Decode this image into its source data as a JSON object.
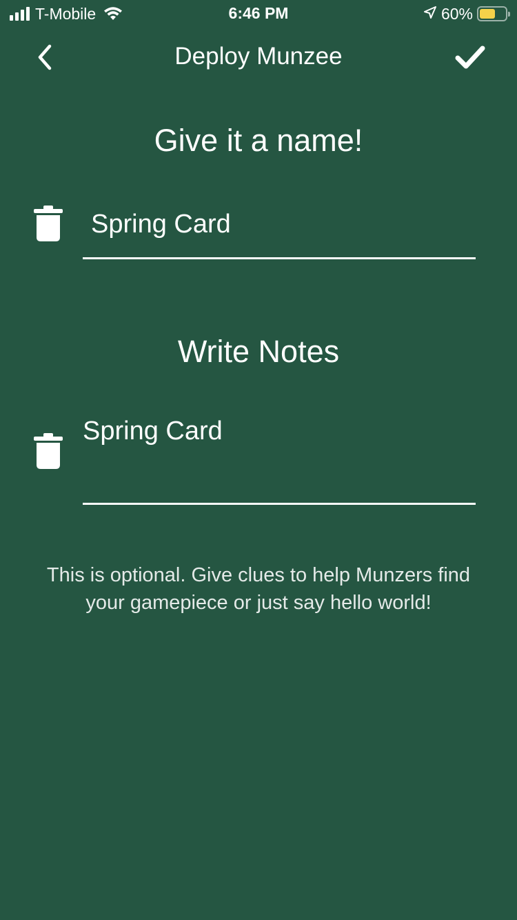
{
  "status_bar": {
    "carrier": "T-Mobile",
    "time": "6:46 PM",
    "battery_percent": "60%",
    "battery_level": 0.6,
    "battery_color": "#f5d24a",
    "icons": [
      "signal-icon",
      "wifi-icon",
      "location-arrow-icon",
      "battery-icon"
    ]
  },
  "nav": {
    "title": "Deploy Munzee",
    "back_icon": "chevron-left-icon",
    "done_icon": "checkmark-icon"
  },
  "name_section": {
    "title": "Give it a name!",
    "value": "Spring Card",
    "clear_icon": "trash-icon"
  },
  "notes_section": {
    "title": "Write Notes",
    "value": "Spring Card",
    "clear_icon": "trash-icon",
    "hint": "This is optional. Give clues to help Munzers find your gamepiece or just say hello world!"
  },
  "colors": {
    "background": "#255642",
    "text": "#ffffff"
  }
}
